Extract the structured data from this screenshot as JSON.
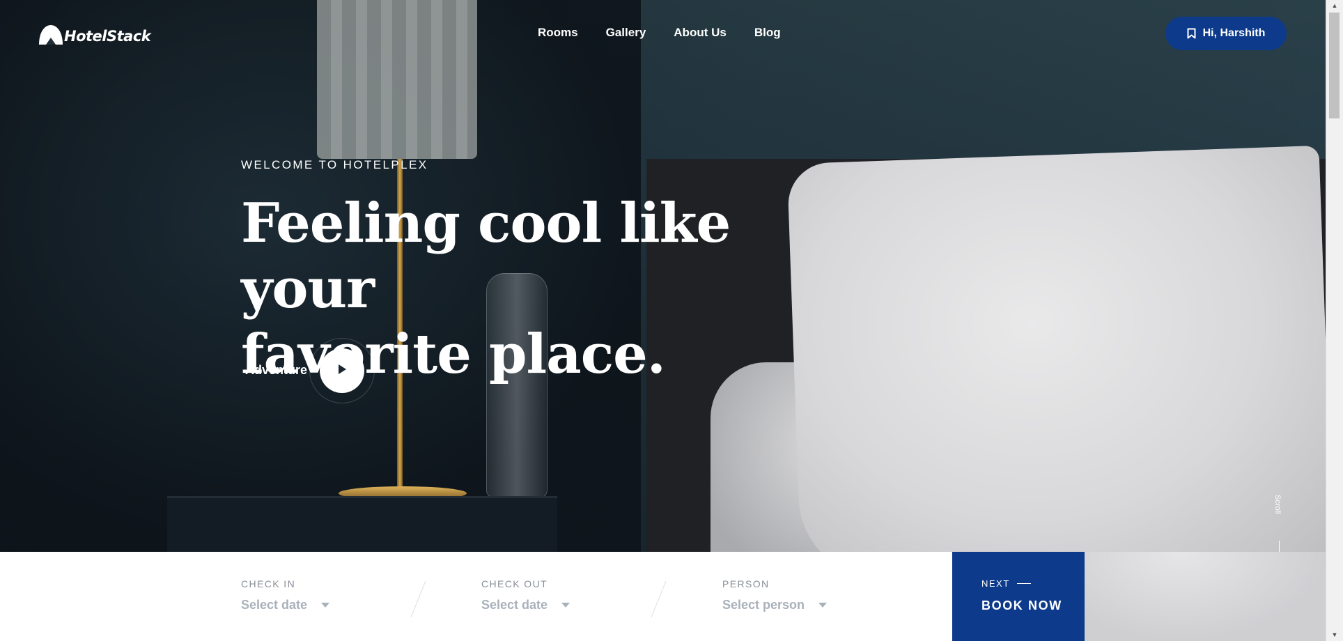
{
  "header": {
    "logo_text": "HotelStack",
    "nav": [
      "Rooms",
      "Gallery",
      "About Us",
      "Blog"
    ],
    "user_button_label": "Hi, Harshith"
  },
  "hero": {
    "subtitle": "WELCOME TO HOTELPLEX",
    "headline_line1": "Feeling cool like your",
    "headline_line2": "favorite place.",
    "adventure_label": "Adventure",
    "scroll_label": "Scroll"
  },
  "booking": {
    "check_in": {
      "label": "CHECK IN",
      "value": "Select date"
    },
    "check_out": {
      "label": "CHECK OUT",
      "value": "Select date"
    },
    "person": {
      "label": "PERSON",
      "value": "Select person"
    },
    "next_label": "NEXT",
    "book_now_label": "BOOK NOW"
  },
  "colors": {
    "primary": "#0d3a8b",
    "placeholder": "#a9b1bb",
    "field_label": "#8a8f97"
  },
  "icons": {
    "logo": "mountain-logo-icon",
    "user": "bookmark-icon",
    "play": "play-icon",
    "caret": "caret-down-icon"
  }
}
